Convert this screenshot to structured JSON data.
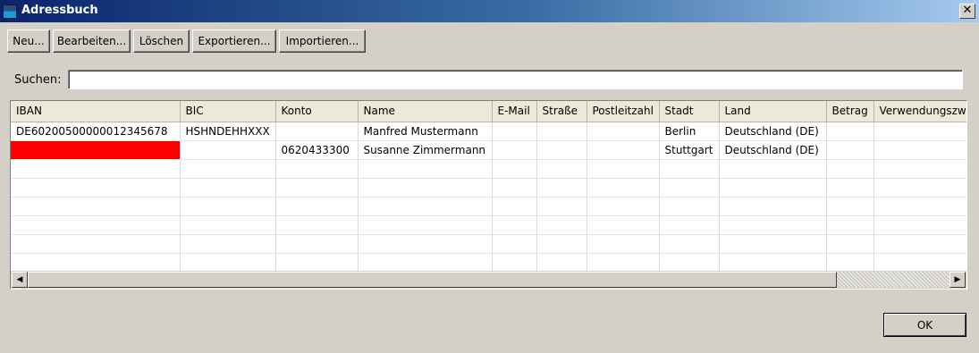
{
  "window": {
    "title": "Adressbuch",
    "close_symbol": "✕"
  },
  "toolbar": {
    "new_label": "Neu...",
    "edit_label": "Bearbeiten...",
    "delete_label": "Löschen",
    "export_label": "Exportieren...",
    "import_label": "Importieren..."
  },
  "search": {
    "label": "Suchen:",
    "value": ""
  },
  "table": {
    "columns": [
      "IBAN",
      "BIC",
      "Konto",
      "Name",
      "E-Mail",
      "Straße",
      "Postleitzahl",
      "Stadt",
      "Land",
      "Betrag",
      "Verwendungszweck"
    ],
    "rows": [
      [
        "DE60200500000012345678",
        "HSHNDEHHXXX",
        "",
        "Manfred Mustermann",
        "",
        "",
        "",
        "Berlin",
        "Deutschland (DE)",
        "",
        ""
      ],
      [
        "",
        "",
        "0620433300",
        "Susanne Zimmermann",
        "",
        "",
        "",
        "Stuttgart",
        "Deutschland (DE)",
        "",
        ""
      ],
      [
        "",
        "",
        "",
        "",
        "",
        "",
        "",
        "",
        "",
        "",
        ""
      ],
      [
        "",
        "",
        "",
        "",
        "",
        "",
        "",
        "",
        "",
        "",
        ""
      ],
      [
        "",
        "",
        "",
        "",
        "",
        "",
        "",
        "",
        "",
        "",
        ""
      ],
      [
        "",
        "",
        "",
        "",
        "",
        "",
        "",
        "",
        "",
        "",
        ""
      ],
      [
        "",
        "",
        "",
        "",
        "",
        "",
        "",
        "",
        "",
        "",
        ""
      ],
      [
        "",
        "",
        "",
        "",
        "",
        "",
        "",
        "",
        "",
        "",
        ""
      ]
    ],
    "invalid_cell_color": "#ff0000"
  },
  "scrollbar": {
    "left_arrow": "◀",
    "right_arrow": "▶"
  },
  "footer": {
    "ok_label": "OK"
  }
}
